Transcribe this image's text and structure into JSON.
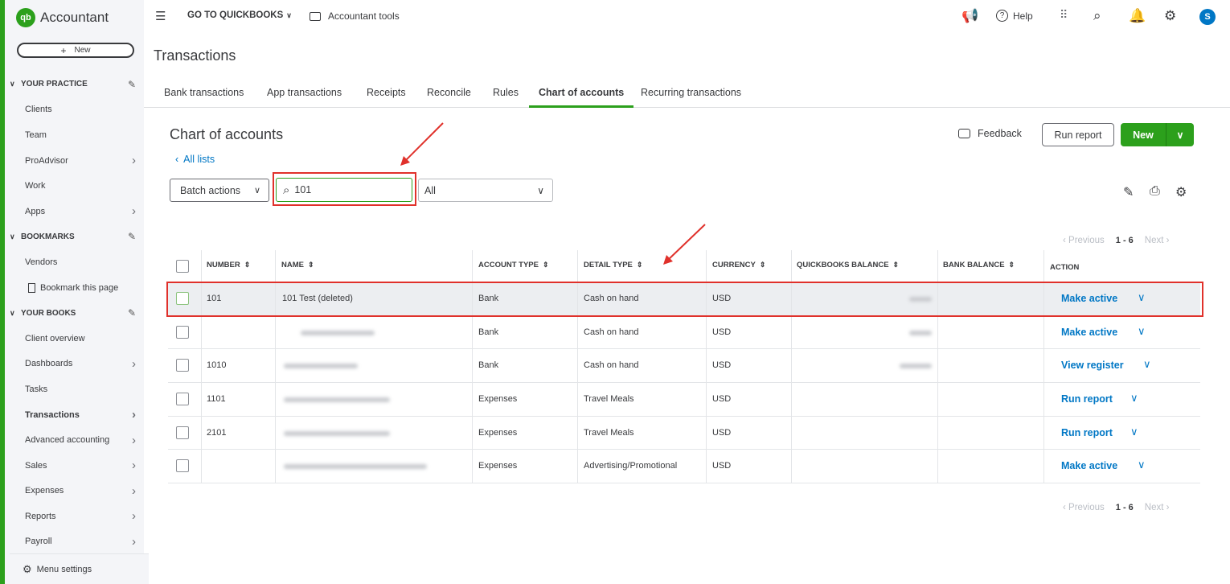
{
  "sidebar": {
    "brand": "Accountant",
    "logo_text": "qb",
    "new_label": "New",
    "new_plus": "+",
    "sections": {
      "your_practice": "YOUR PRACTICE",
      "bookmarks": "BOOKMARKS",
      "your_books": "YOUR BOOKS"
    },
    "items": {
      "clients": "Clients",
      "team": "Team",
      "proadvisor": "ProAdvisor",
      "work": "Work",
      "apps": "Apps",
      "vendors": "Vendors",
      "bookmark_page": "Bookmark this page",
      "client_overview": "Client overview",
      "dashboards": "Dashboards",
      "tasks": "Tasks",
      "transactions": "Transactions",
      "advanced_accounting": "Advanced accounting",
      "sales": "Sales",
      "expenses": "Expenses",
      "reports": "Reports",
      "payroll": "Payroll"
    },
    "menu_settings": "Menu settings"
  },
  "topbar": {
    "go_to": "GO TO QUICKBOOKS",
    "accountant_tools": "Accountant tools",
    "help": "Help",
    "avatar_initial": "S"
  },
  "page_title": "Transactions",
  "tabs": [
    "Bank transactions",
    "App transactions",
    "Receipts",
    "Reconcile",
    "Rules",
    "Chart of accounts",
    "Recurring transactions"
  ],
  "coa": {
    "title": "Chart of accounts",
    "all_lists": "All lists",
    "feedback": "Feedback",
    "run_report": "Run report",
    "new": "New",
    "batch_actions": "Batch actions",
    "search_value": "101",
    "filter_value": "All"
  },
  "pager": {
    "previous": "Previous",
    "range": "1 - 6",
    "next": "Next"
  },
  "table": {
    "headers": {
      "number": "NUMBER",
      "name": "NAME",
      "account_type": "ACCOUNT TYPE",
      "detail_type": "DETAIL TYPE",
      "currency": "CURRENCY",
      "qb_balance": "QUICKBOOKS BALANCE",
      "bank_balance": "BANK BALANCE",
      "action": "ACTION"
    },
    "rows": [
      {
        "number": "101",
        "name": "101 Test (deleted)",
        "account_type": "Bank",
        "detail_type": "Cash on hand",
        "currency": "USD",
        "action": "Make active"
      },
      {
        "number": "",
        "name": "",
        "account_type": "Bank",
        "detail_type": "Cash on hand",
        "currency": "USD",
        "action": "Make active"
      },
      {
        "number": "1010",
        "name": "",
        "account_type": "Bank",
        "detail_type": "Cash on hand",
        "currency": "USD",
        "action": "View register"
      },
      {
        "number": "1101",
        "name": "",
        "account_type": "Expenses",
        "detail_type": "Travel Meals",
        "currency": "USD",
        "action": "Run report"
      },
      {
        "number": "2101",
        "name": "",
        "account_type": "Expenses",
        "detail_type": "Travel Meals",
        "currency": "USD",
        "action": "Run report"
      },
      {
        "number": "",
        "name": "",
        "account_type": "Expenses",
        "detail_type": "Advertising/Promotional",
        "currency": "USD",
        "action": "Make active"
      }
    ]
  },
  "colors": {
    "brand_green": "#2ca01c",
    "link_blue": "#0077c5",
    "annotation_red": "#e0312b"
  }
}
